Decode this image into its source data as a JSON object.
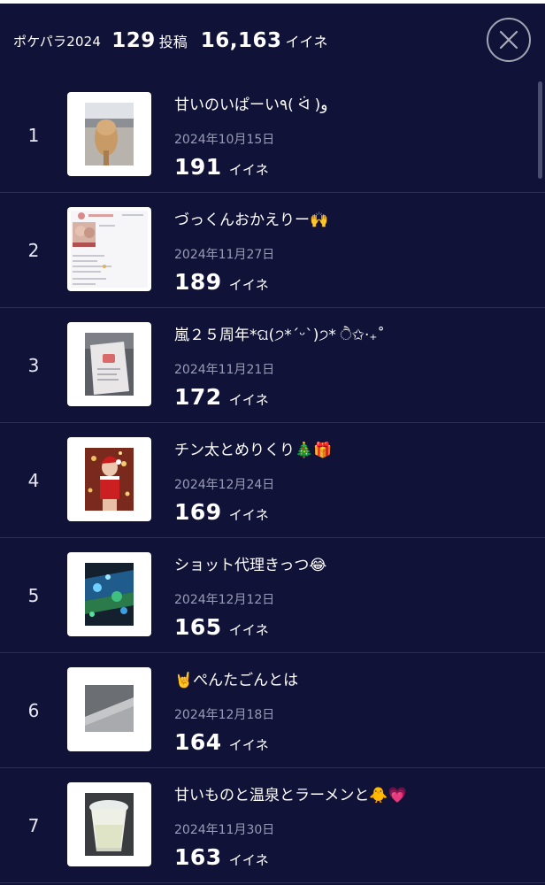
{
  "header": {
    "app_name": "ポケパラ2024",
    "post_count": "129",
    "post_unit": "投稿",
    "like_count": "16,163",
    "like_unit": "イイネ",
    "close_icon": "close-icon"
  },
  "colors": {
    "background": "#111238",
    "divider": "#2b2d55",
    "date_text": "#9a9cb6",
    "close_ring": "#a2a4b4"
  },
  "posts": [
    {
      "rank": "1",
      "title": "甘いのいぱーい٩( ᐛ )و",
      "date": "2024年10月15日",
      "likes": "191",
      "likes_unit": "イイネ"
    },
    {
      "rank": "2",
      "title": "づっくんおかえりー🙌",
      "date": "2024年11月27日",
      "likes": "189",
      "likes_unit": "イイネ"
    },
    {
      "rank": "3",
      "title": "嵐２５周年*ଘ(੭*ˊᵕˋ)੭* ੈ✩‧₊˚",
      "date": "2024年11月21日",
      "likes": "172",
      "likes_unit": "イイネ"
    },
    {
      "rank": "4",
      "title": "チン太とめりくり🎄🎁",
      "date": "2024年12月24日",
      "likes": "169",
      "likes_unit": "イイネ"
    },
    {
      "rank": "5",
      "title": "ショット代理きっつ😂",
      "date": "2024年12月12日",
      "likes": "165",
      "likes_unit": "イイネ"
    },
    {
      "rank": "6",
      "title": "🤘ぺんたごんとは",
      "date": "2024年12月18日",
      "likes": "164",
      "likes_unit": "イイネ"
    },
    {
      "rank": "7",
      "title": "甘いものと温泉とラーメンと🐥💗",
      "date": "2024年11月30日",
      "likes": "163",
      "likes_unit": "イイネ"
    }
  ]
}
